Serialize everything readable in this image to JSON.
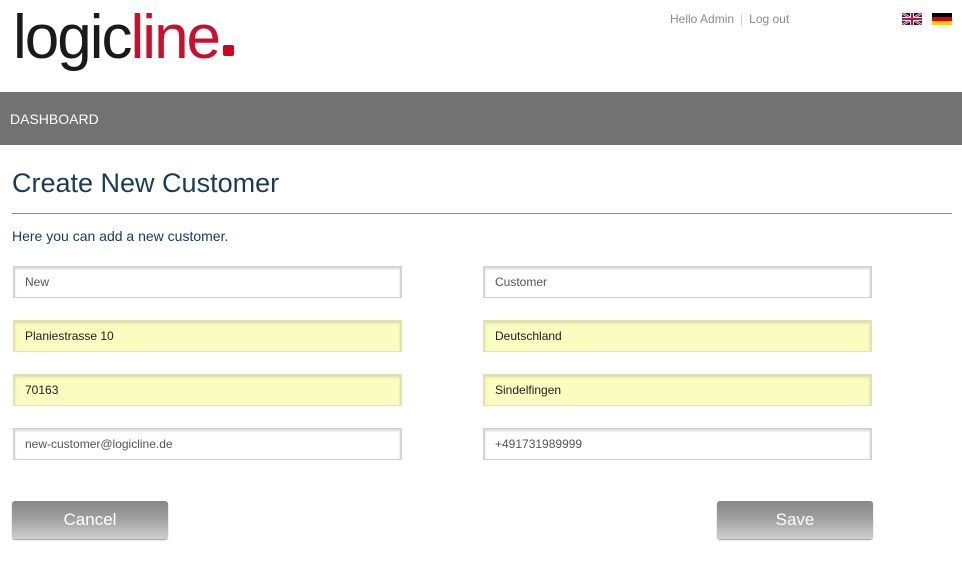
{
  "brand": {
    "logo_dark": "logic",
    "logo_red": "line"
  },
  "user_nav": {
    "greeting": "Hello Admin",
    "separator": "|",
    "logout": "Log out"
  },
  "languages": [
    "english-flag-icon",
    "german-flag-icon"
  ],
  "nav": {
    "items": [
      {
        "label": "DASHBOARD"
      }
    ]
  },
  "page": {
    "title": "Create New Customer",
    "intro": "Here you can add a new customer."
  },
  "form": {
    "first_name": {
      "value": "New",
      "state": "default"
    },
    "last_name": {
      "value": "Customer",
      "state": "default"
    },
    "street": {
      "value": "Planiestrasse 10",
      "state": "autofilled"
    },
    "country": {
      "value": "Deutschland",
      "state": "autofilled"
    },
    "zip": {
      "value": "70163",
      "state": "autofilled"
    },
    "city": {
      "value": "Sindelfingen",
      "state": "autofilled"
    },
    "email": {
      "value": "new-customer@logicline.de",
      "state": "default"
    },
    "phone": {
      "value": "+491731989999",
      "state": "default"
    }
  },
  "actions": {
    "cancel_label": "Cancel",
    "save_label": "Save"
  },
  "colors": {
    "nav_bg": "#727272",
    "title": "#163c58",
    "brand_red": "#c8102e",
    "autofill_bg": "#fafcc0"
  }
}
